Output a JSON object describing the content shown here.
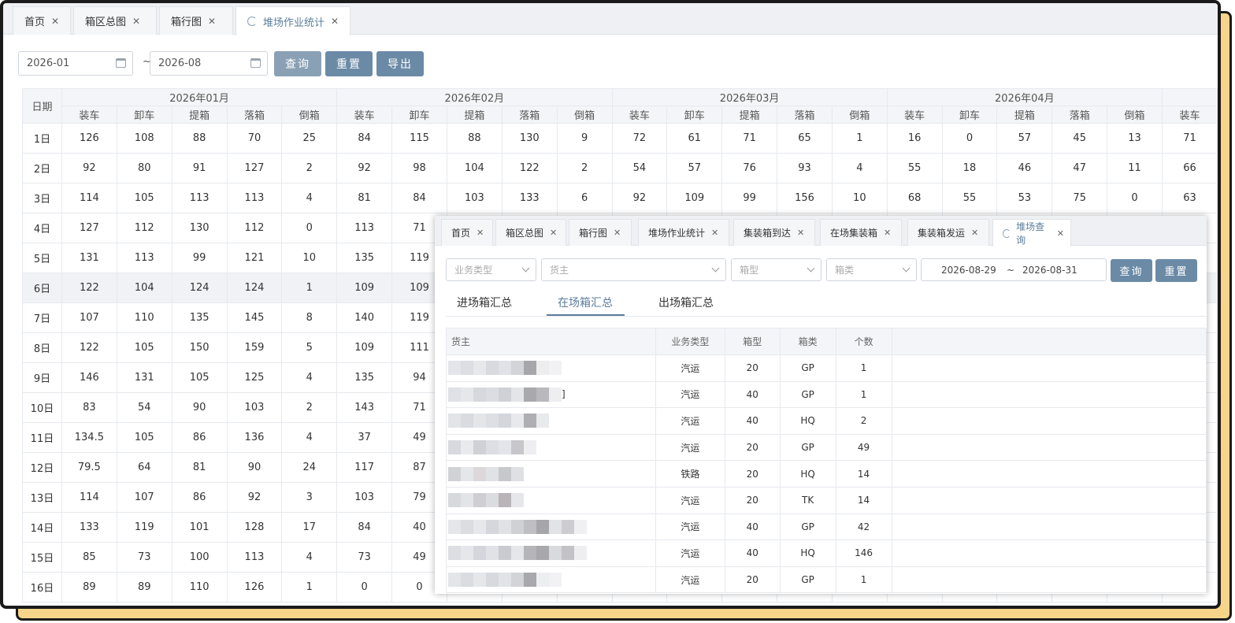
{
  "tabs": [
    {
      "label": "首页"
    },
    {
      "label": "箱区总图"
    },
    {
      "label": "箱行图"
    },
    {
      "label": "堆场作业统计",
      "active": true
    }
  ],
  "filters": {
    "from": "2026-01",
    "to": "2026-08",
    "tilde": "~"
  },
  "buttons": {
    "query": "查询",
    "reset": "重置",
    "export": "导出"
  },
  "colors": {
    "query": "#8aa0b4",
    "reset": "#6b8aa6",
    "export": "#6b8aa6",
    "accent": "#5b7d9b"
  },
  "table": {
    "date_header": "日期",
    "months": [
      "2026年01月",
      "2026年02月",
      "2026年03月",
      "2026年04月"
    ],
    "ops": [
      "装车",
      "卸车",
      "提箱",
      "落箱",
      "倒箱"
    ],
    "extra_op": "装车",
    "rows": [
      {
        "d": "1日",
        "v": [
          "126",
          "108",
          "88",
          "70",
          "25",
          "84",
          "115",
          "88",
          "130",
          "9",
          "72",
          "61",
          "71",
          "65",
          "1",
          "16",
          "0",
          "57",
          "45",
          "13",
          "71"
        ]
      },
      {
        "d": "2日",
        "v": [
          "92",
          "80",
          "91",
          "127",
          "2",
          "92",
          "98",
          "104",
          "122",
          "2",
          "54",
          "57",
          "76",
          "93",
          "4",
          "55",
          "18",
          "46",
          "47",
          "11",
          "66"
        ]
      },
      {
        "d": "3日",
        "v": [
          "114",
          "105",
          "113",
          "113",
          "4",
          "81",
          "84",
          "103",
          "133",
          "6",
          "92",
          "109",
          "99",
          "156",
          "10",
          "68",
          "55",
          "53",
          "75",
          "0",
          "63"
        ]
      },
      {
        "d": "4日",
        "v": [
          "127",
          "112",
          "130",
          "112",
          "0",
          "113",
          "71"
        ]
      },
      {
        "d": "5日",
        "v": [
          "131",
          "113",
          "99",
          "121",
          "10",
          "135",
          "119"
        ]
      },
      {
        "d": "6日",
        "v": [
          "122",
          "104",
          "124",
          "124",
          "1",
          "109",
          "109"
        ]
      },
      {
        "d": "7日",
        "v": [
          "107",
          "110",
          "135",
          "145",
          "8",
          "140",
          "119"
        ]
      },
      {
        "d": "8日",
        "v": [
          "122",
          "105",
          "150",
          "159",
          "5",
          "109",
          "111"
        ]
      },
      {
        "d": "9日",
        "v": [
          "146",
          "131",
          "105",
          "125",
          "4",
          "135",
          "94"
        ]
      },
      {
        "d": "10日",
        "v": [
          "83",
          "54",
          "90",
          "103",
          "2",
          "143",
          "71"
        ]
      },
      {
        "d": "11日",
        "v": [
          "134.5",
          "105",
          "86",
          "136",
          "4",
          "37",
          "49"
        ]
      },
      {
        "d": "12日",
        "v": [
          "79.5",
          "64",
          "81",
          "90",
          "24",
          "117",
          "87"
        ]
      },
      {
        "d": "13日",
        "v": [
          "114",
          "107",
          "86",
          "92",
          "3",
          "103",
          "79"
        ]
      },
      {
        "d": "14日",
        "v": [
          "133",
          "119",
          "101",
          "128",
          "17",
          "84",
          "40"
        ]
      },
      {
        "d": "15日",
        "v": [
          "85",
          "73",
          "100",
          "113",
          "4",
          "73",
          "49"
        ]
      },
      {
        "d": "16日",
        "v": [
          "89",
          "89",
          "110",
          "126",
          "1",
          "0",
          "0"
        ]
      }
    ]
  },
  "overlay": {
    "tabs": [
      {
        "label": "首页"
      },
      {
        "label": "箱区总图"
      },
      {
        "label": "箱行图"
      },
      {
        "label": "堆场作业统计"
      },
      {
        "label": "集装箱到达"
      },
      {
        "label": "在场集装箱"
      },
      {
        "label": "集装箱发运"
      },
      {
        "label": "堆场查询",
        "active": true
      }
    ],
    "filters": {
      "biz_type": "业务类型",
      "owner": "货主",
      "size": "箱型",
      "kind": "箱类",
      "date_from": "2026-08-29",
      "tilde": "~",
      "date_to": "2026-08-31"
    },
    "buttons": {
      "query": "查询",
      "reset": "重置"
    },
    "subtabs": [
      {
        "label": "进场箱汇总"
      },
      {
        "label": "在场箱汇总",
        "active": true
      },
      {
        "label": "出场箱汇总"
      }
    ],
    "headers": {
      "owner": "货主",
      "biz": "业务类型",
      "size": "箱型",
      "kind": "箱类",
      "count": "个数"
    },
    "rows": [
      {
        "owner": "",
        "biz": "汽运",
        "size": "20",
        "kind": "GP",
        "count": "1"
      },
      {
        "owner": "]",
        "biz": "汽运",
        "size": "40",
        "kind": "GP",
        "count": "1"
      },
      {
        "owner": "",
        "biz": "汽运",
        "size": "40",
        "kind": "HQ",
        "count": "2"
      },
      {
        "owner": "",
        "biz": "汽运",
        "size": "20",
        "kind": "GP",
        "count": "49"
      },
      {
        "owner": "",
        "biz": "铁路",
        "size": "20",
        "kind": "HQ",
        "count": "14"
      },
      {
        "owner": "",
        "biz": "汽运",
        "size": "20",
        "kind": "TK",
        "count": "14"
      },
      {
        "owner": "",
        "biz": "汽运",
        "size": "40",
        "kind": "GP",
        "count": "42"
      },
      {
        "owner": "",
        "biz": "汽运",
        "size": "40",
        "kind": "HQ",
        "count": "146"
      },
      {
        "owner": "",
        "biz": "汽运",
        "size": "20",
        "kind": "GP",
        "count": "1"
      }
    ]
  }
}
